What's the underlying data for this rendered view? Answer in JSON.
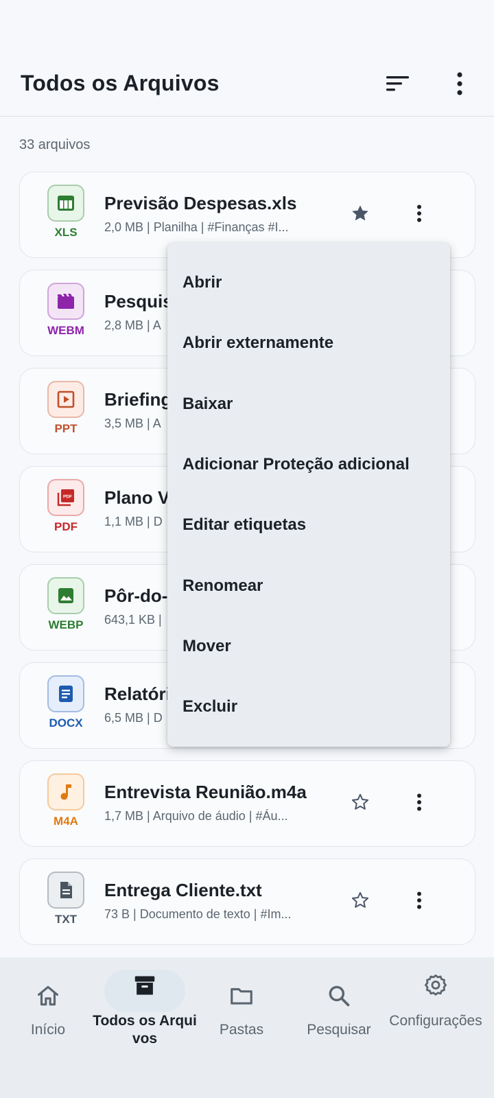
{
  "app_bar": {
    "title": "Todos os Arquivos",
    "sort_icon": "sort-icon",
    "more_icon": "more-vert-icon"
  },
  "file_count": "33 arquivos",
  "files": [
    {
      "icon": "table-icon",
      "type": "XLS",
      "name": "Previsão Despesas.xls",
      "meta": "2,0 MB | Planilha | #Finanças  #I...",
      "starred": true,
      "color": "#2e7d32",
      "bg": "#e8f5e9"
    },
    {
      "icon": "video-icon",
      "type": "WEBM",
      "name": "Pesquis",
      "meta": "2,8 MB | A",
      "starred": false,
      "color": "#8e24aa",
      "bg": "#f3e5f5"
    },
    {
      "icon": "slideshow-icon",
      "type": "PPT",
      "name": "Briefing",
      "meta": "3,5 MB | A",
      "starred": false,
      "color": "#c0502a",
      "bg": "#fdece6"
    },
    {
      "icon": "pdf-icon",
      "type": "PDF",
      "name": "Plano V",
      "meta": "1,1 MB | D",
      "starred": false,
      "color": "#c62828",
      "bg": "#fdeaea"
    },
    {
      "icon": "image-icon",
      "type": "WEBP",
      "name": "Pôr-do-s",
      "meta": "643,1 KB |",
      "starred": false,
      "color": "#2e7d32",
      "bg": "#e8f5e9"
    },
    {
      "icon": "document-icon",
      "type": "DOCX",
      "name": "Relatóri",
      "meta": "6,5 MB | D",
      "starred": false,
      "color": "#1e5bb0",
      "bg": "#e6eefb"
    },
    {
      "icon": "music-note-icon",
      "type": "M4A",
      "name": "Entrevista Reunião.m4a",
      "meta": "1,7 MB | Arquivo de áudio | #Áu...",
      "starred": false,
      "color": "#e07a10",
      "bg": "#fff1e2"
    },
    {
      "icon": "text-file-icon",
      "type": "TXT",
      "name": "Entrega Cliente.txt",
      "meta": "73 B | Documento de texto | #Im...",
      "starred": false,
      "color": "#4a5560",
      "bg": "#eceff2"
    }
  ],
  "context_menu": [
    "Abrir",
    "Abrir externamente",
    "Baixar",
    "Adicionar Proteção adicional",
    "Editar etiquetas",
    "Renomear",
    "Mover",
    "Excluir"
  ],
  "bottom_nav": [
    {
      "icon": "home-icon",
      "label": "Início",
      "active": false
    },
    {
      "icon": "archive-icon",
      "label": "Todos os Arquivos",
      "active": true
    },
    {
      "icon": "folder-icon",
      "label": "Pastas",
      "active": false
    },
    {
      "icon": "search-icon",
      "label": "Pesquisar",
      "active": false
    },
    {
      "icon": "settings-icon",
      "label": "Configurações",
      "active": false
    }
  ],
  "colors": {
    "background": "#f6f8fb",
    "menu": "#e9edf2",
    "text": "#1c2128",
    "muted": "#5c6670"
  }
}
